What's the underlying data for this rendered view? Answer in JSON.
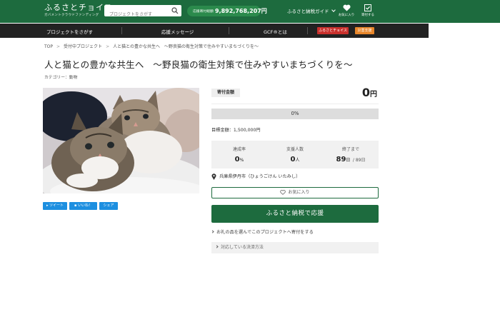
{
  "header": {
    "logo_main": "ふるさとチョイス",
    "logo_sub": "ガバメントクラウドファンディング",
    "search_placeholder": "プロジェクトをさがす",
    "total_label": "応援寄付総額",
    "total_value": "9,892,768,207円",
    "guide_label": "ふるさと納税ガイド",
    "favorites_label": "お気に入り",
    "donated_label": "寄付する"
  },
  "nav": {
    "find_project": "プロジェクトをさがす",
    "messages": "応援メッセージ",
    "about_gcf": "GCF®とは",
    "badge_choice": "ふるさとチョイス",
    "badge_disaster": "災害支援"
  },
  "breadcrumb": [
    "TOP",
    "受付中プロジェクト",
    "人と猫との豊かな共生へ　～野良猫の衛生対策で住みやすいまちづくりを～"
  ],
  "project": {
    "title": "人と猫との豊かな共生へ　～野良猫の衛生対策で住みやすいまちづくりを～",
    "category": "カテゴリー：動物"
  },
  "share": {
    "tweet": "ツイート",
    "like": "いいね！",
    "share": "シェア"
  },
  "donation": {
    "label": "寄付金額",
    "amount": "0",
    "unit": "円",
    "progress_text": "0%",
    "progress_fraction": 0,
    "target": "目標金額：1,500,000円"
  },
  "stats": {
    "rate_label": "達成率",
    "rate_value": "0",
    "rate_unit": "%",
    "supporters_label": "支援人数",
    "supporters_value": "0",
    "supporters_unit": "人",
    "days_label": "終了まで",
    "days_value": "89",
    "days_unit": "日",
    "days_total": "/ 89日"
  },
  "location": "兵庫県伊丹市（ひょうごけん いたみし）",
  "buttons": {
    "favorite": "お気に入り",
    "donate": "ふるさと納税で応援",
    "gift_link": "お礼の品を選んでこのプロジェクトへ寄付をする",
    "payment": "対応している決済方法"
  },
  "colors": {
    "brand_green": "#1d6b3e",
    "twitter_blue": "#1d8fe0",
    "badge_red": "#c9302c",
    "badge_orange": "#e8862a"
  }
}
